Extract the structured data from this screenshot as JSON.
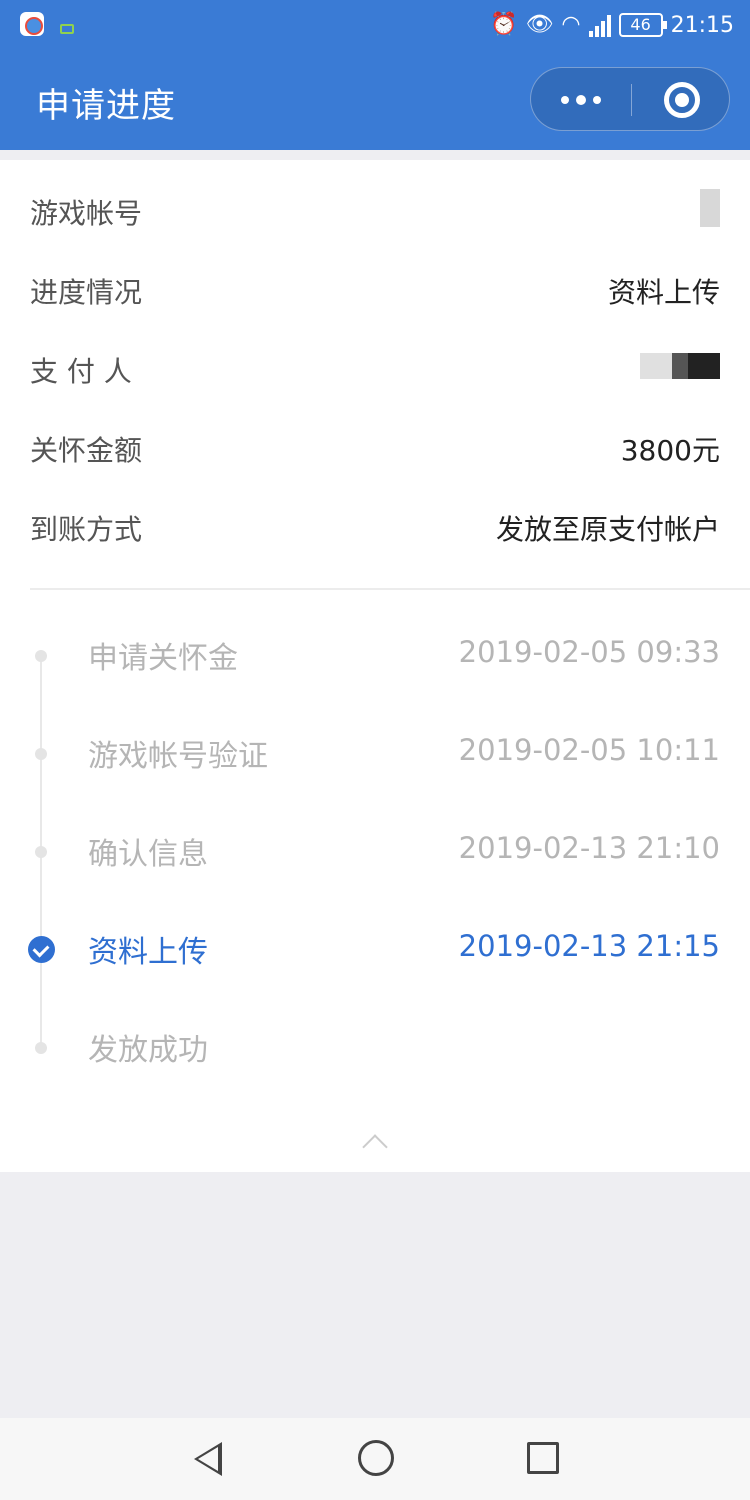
{
  "status_bar": {
    "time": "21:15",
    "battery": "46",
    "network": "4G",
    "icons": [
      "alarm-icon",
      "eye-icon",
      "wifi-icon",
      "signal-icon",
      "battery-icon"
    ]
  },
  "header": {
    "title": "申请进度"
  },
  "info": {
    "rows": [
      {
        "label": "游戏帐号",
        "value": ""
      },
      {
        "label": "进度情况",
        "value": "资料上传"
      },
      {
        "label": "支 付 人",
        "value": ""
      },
      {
        "label": "关怀金额",
        "value": "3800元"
      },
      {
        "label": "到账方式",
        "value": "发放至原支付帐户"
      }
    ]
  },
  "timeline": {
    "steps": [
      {
        "name": "申请关怀金",
        "time": "2019-02-05 09:33",
        "state": "done"
      },
      {
        "name": "游戏帐号验证",
        "time": "2019-02-05 10:11",
        "state": "done"
      },
      {
        "name": "确认信息",
        "time": "2019-02-13 21:10",
        "state": "done"
      },
      {
        "name": "资料上传",
        "time": "2019-02-13 21:15",
        "state": "current"
      },
      {
        "name": "发放成功",
        "time": "",
        "state": "pending"
      }
    ]
  },
  "colors": {
    "header_bg": "#3a7bd5",
    "active": "#2f6fd1",
    "inactive_text": "#b5b5b5"
  }
}
